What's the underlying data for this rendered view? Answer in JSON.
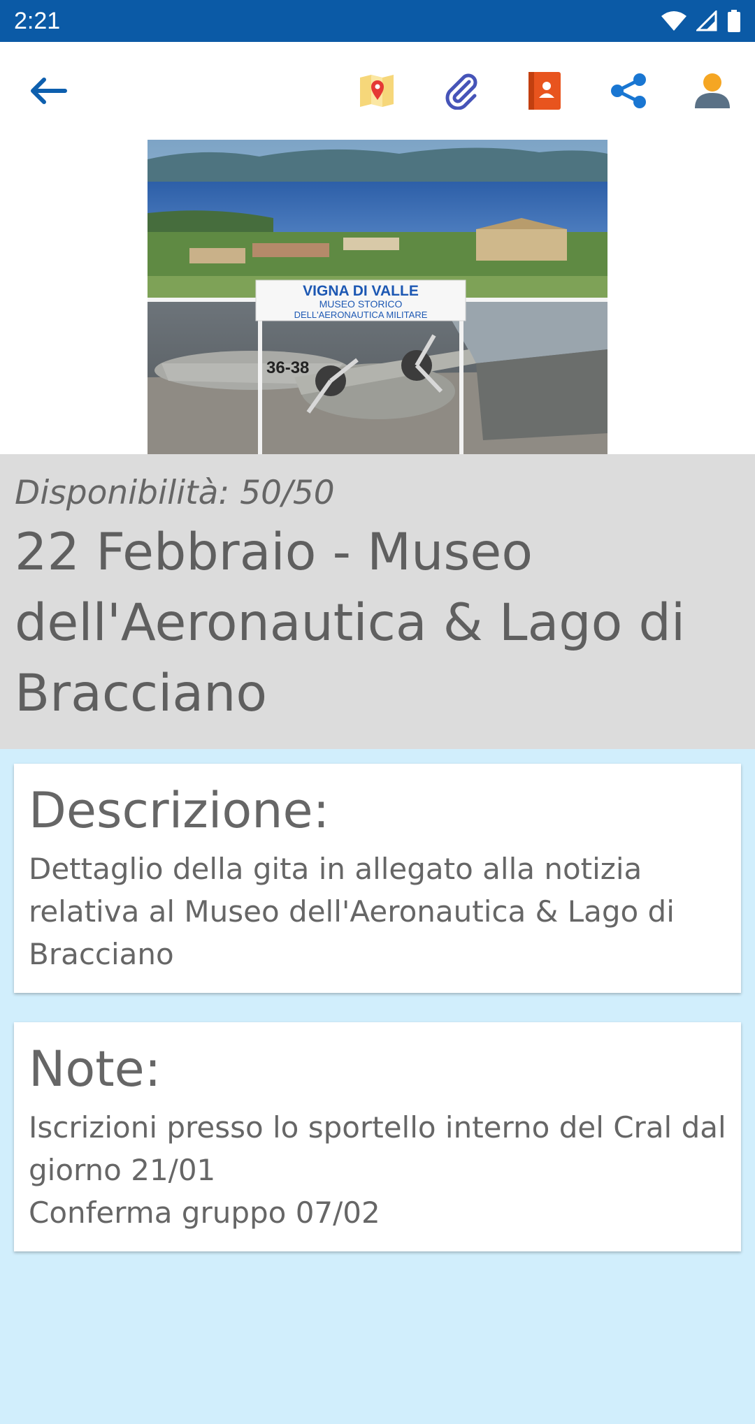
{
  "status_bar": {
    "time": "2:21"
  },
  "toolbar": {
    "back_icon": "arrow-left-icon",
    "map_icon": "map-pin-icon",
    "attachment_icon": "paperclip-icon",
    "contacts_icon": "contact-book-icon",
    "share_icon": "share-icon",
    "profile_icon": "person-icon"
  },
  "hero": {
    "sign_line1": "VIGNA DI VALLE",
    "sign_line2": "MUSEO STORICO",
    "sign_line3": "DELL'AERONAUTICA MILITARE",
    "plane_code": "36-38"
  },
  "event": {
    "availability": "Disponibilità: 50/50",
    "title": "22 Febbraio - Museo dell'Aeronautica & Lago di Bracciano"
  },
  "description": {
    "heading": "Descrizione:",
    "body": "Dettaglio della gita in allegato alla notizia relativa al Museo dell'Aeronautica & Lago di Bracciano"
  },
  "notes": {
    "heading": "Note:",
    "body": "Iscrizioni presso lo sportello interno del Cral dal giorno 21/01\nConferma gruppo 07/02"
  },
  "colors": {
    "status_bar": "#0b5aa6",
    "page_background": "#d1eefc",
    "title_panel": "#dcdcdc",
    "icon_blue": "#0d5fae"
  }
}
